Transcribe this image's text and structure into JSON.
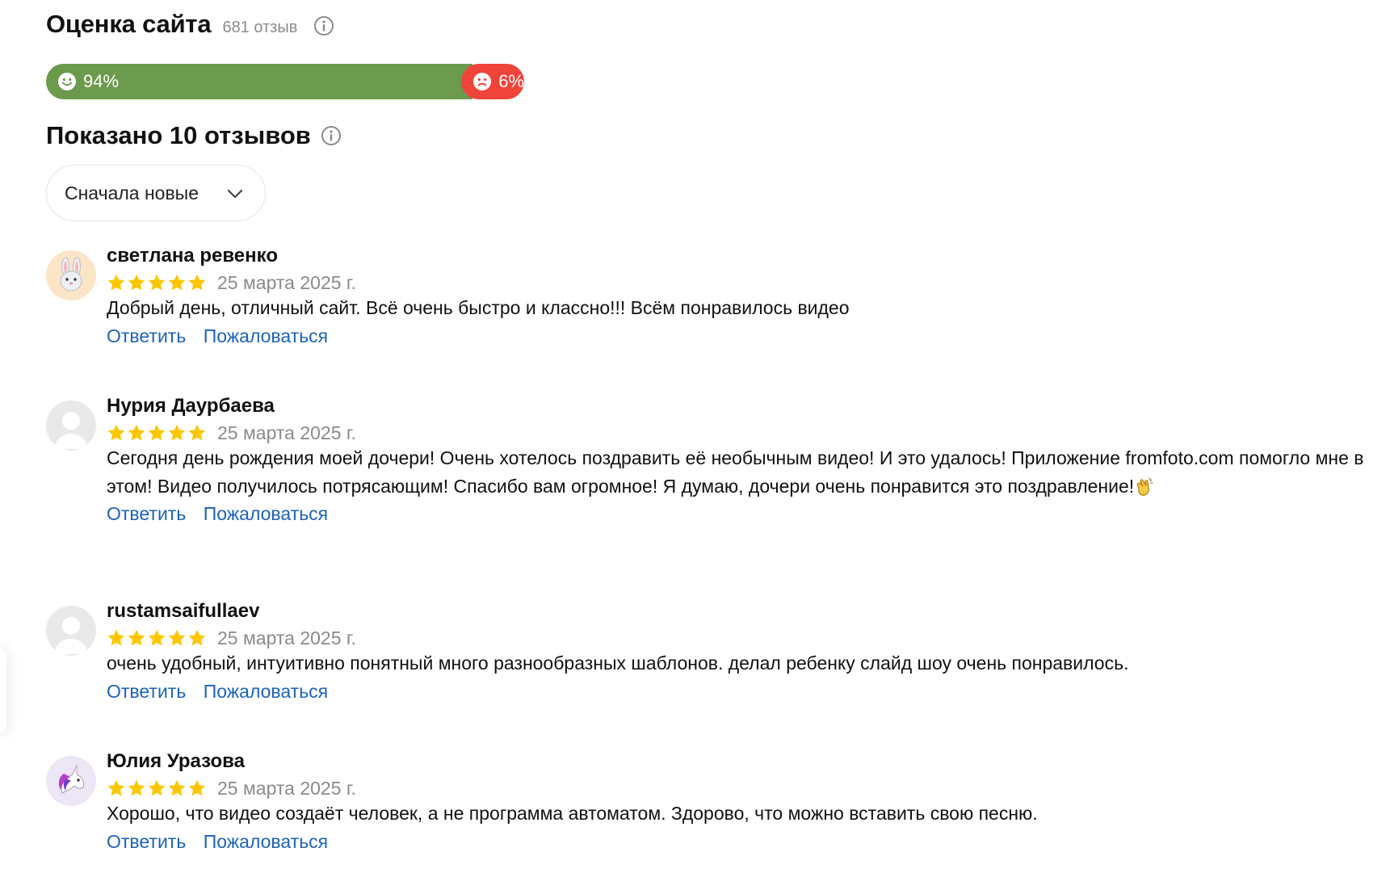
{
  "header": {
    "title": "Оценка сайта",
    "count": "681 отзыв"
  },
  "sentiment": {
    "positive_label": "94%",
    "negative_label": "6%",
    "positive_fraction": 0.94,
    "negative_fraction": 0.06,
    "positive_color": "#6b9a4c",
    "negative_color": "#f0433a"
  },
  "shown": {
    "title": "Показано 10 отзывов"
  },
  "sort": {
    "selected": "Сначала новые"
  },
  "reviews": [
    {
      "author": "светлана ревенко",
      "avatar_icon": "bunny-icon",
      "rating": 5,
      "date": "25 марта 2025 г.",
      "text": "Добрый день, отличный сайт. Всё очень быстро и классно!!! Всём понравилось видео",
      "reply": "Ответить",
      "report": "Пожаловаться"
    },
    {
      "author": "Нурия Даурбаева",
      "avatar_icon": "default-user-icon",
      "rating": 5,
      "date": "25 марта 2025 г.",
      "text": "Сегодня день рождения моей дочери! Очень хотелось поздравить её необычным видео! И это удалось! Приложение fromfoto.com помогло мне в этом! Видео получилось потрясающим! Спасибо вам огромное! Я думаю, дочери очень понравится это поздравление!",
      "emoji": "clapping-hands-icon",
      "reply": "Ответить",
      "report": "Пожаловаться"
    },
    {
      "author": "rustamsaifullaev",
      "avatar_icon": "default-user-icon",
      "rating": 5,
      "date": "25 марта 2025 г.",
      "text": "очень удобный, интуитивно понятный много разнообразных шаблонов. делал ребенку слайд шоу очень понравилось.",
      "reply": "Ответить",
      "report": "Пожаловаться"
    },
    {
      "author": "Юлия Уразова",
      "avatar_icon": "unicorn-icon",
      "rating": 5,
      "date": "25 марта 2025 г.",
      "text": "Хорошо, что видео создаёт человек, а не программа автоматом. Здорово, что можно вставить свою песню.",
      "reply": "Ответить",
      "report": "Пожаловаться"
    }
  ]
}
